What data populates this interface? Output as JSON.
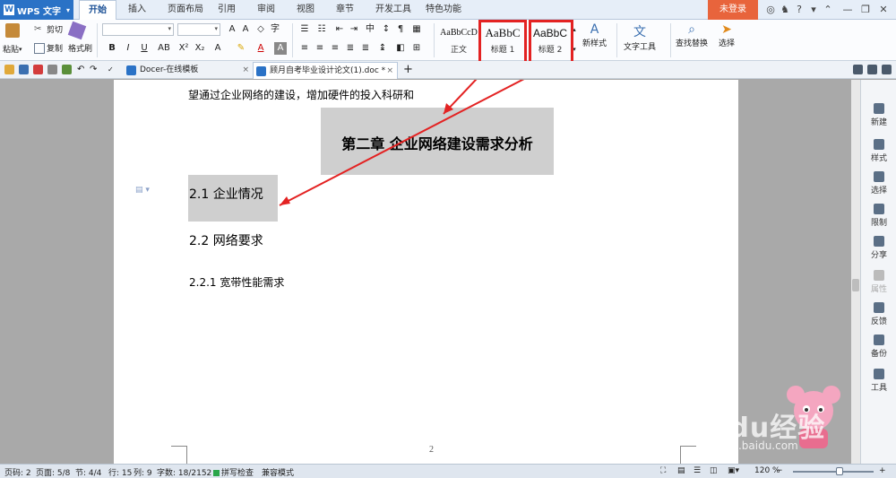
{
  "app": {
    "name": "WPS 文字"
  },
  "ribbon_tabs": [
    "开始",
    "插入",
    "页面布局",
    "引用",
    "审阅",
    "视图",
    "章节",
    "开发工具",
    "特色功能"
  ],
  "active_tab": "开始",
  "login": "未登录",
  "ribbon": {
    "paste": "粘贴",
    "cut": "剪切",
    "copy": "复制",
    "format_painter": "格式刷",
    "styles": [
      {
        "sample": "AaBbCcD",
        "name": "正文"
      },
      {
        "sample": "AaBbC",
        "name": "标题 1"
      },
      {
        "sample": "AaBbC",
        "name": "标题 2"
      }
    ],
    "new_style": "新样式",
    "text_tools": "文字工具",
    "find_replace": "查找替换",
    "select": "选择"
  },
  "doc_tabs": [
    {
      "label": "Docer-在线模板",
      "active": false
    },
    {
      "label": "顾月自考毕业设计论文(1).doc *",
      "active": true
    }
  ],
  "document": {
    "line1": "望通过企业网络的建设，增加硬件的投入科研和",
    "chapter_heading": "第二章  企业网络建设需求分析",
    "h2_1": "2.1 企业情况",
    "h2_2": "2.2 网络要求",
    "h3_1": "2.2.1 宽带性能需求",
    "page_number": "2"
  },
  "right_panel": [
    {
      "label": "新建",
      "icon": "new-doc-icon",
      "disabled": false
    },
    {
      "label": "样式",
      "icon": "style-icon",
      "disabled": false
    },
    {
      "label": "选择",
      "icon": "select-icon",
      "disabled": false
    },
    {
      "label": "限制",
      "icon": "restrict-icon",
      "disabled": false
    },
    {
      "label": "分享",
      "icon": "share-icon",
      "disabled": false
    },
    {
      "label": "属性",
      "icon": "properties-icon",
      "disabled": true
    },
    {
      "label": "反馈",
      "icon": "feedback-icon",
      "disabled": false
    },
    {
      "label": "备份",
      "icon": "backup-icon",
      "disabled": false
    },
    {
      "label": "工具",
      "icon": "tools-icon",
      "disabled": false
    }
  ],
  "status": {
    "page_code": "页码: 2",
    "pages": "页面: 5/8",
    "section": "节: 4/4",
    "row": "行: 15",
    "col": "列: 9",
    "word_count": "字数: 18/2152",
    "spell_check": "拼写检查",
    "compat_mode": "兼容模式",
    "zoom": "120 %"
  },
  "watermark": {
    "text": "Baidu经验",
    "sub": "jingyan.baidu.com"
  },
  "colors": {
    "accent": "#2a72c6",
    "login": "#e8643c",
    "annotation": "#e32222",
    "heading_highlight": "#cfcfcf"
  }
}
